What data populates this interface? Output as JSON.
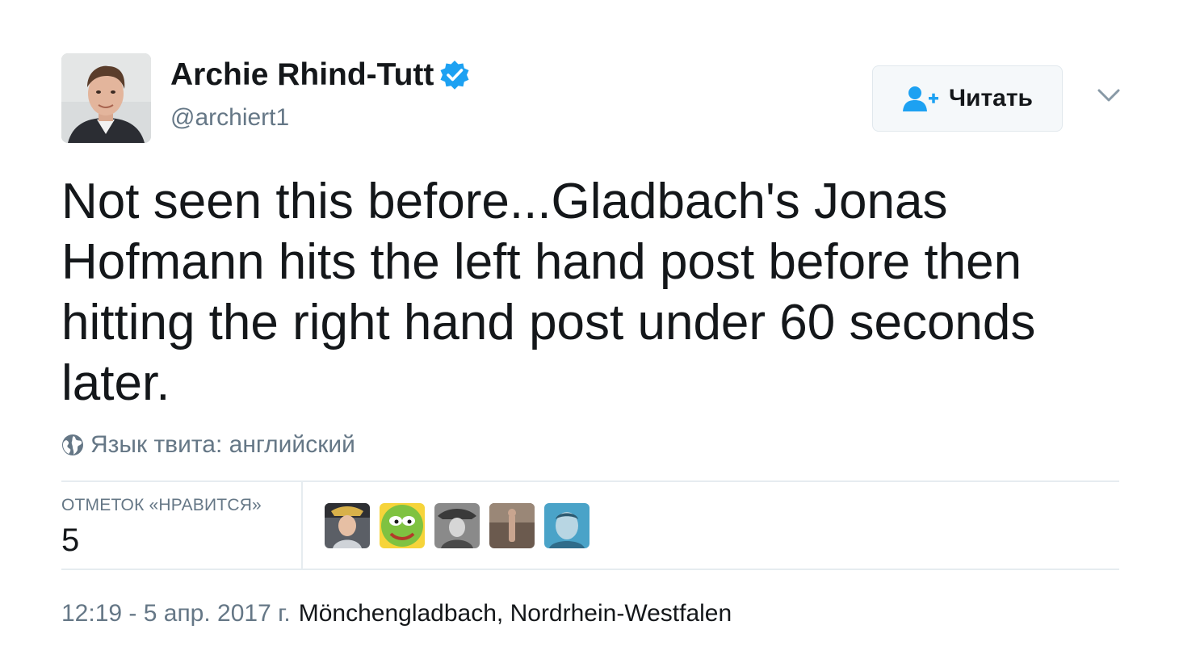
{
  "author": {
    "display_name": "Archie Rhind-Tutt",
    "handle": "@archiert1",
    "verified": true
  },
  "follow_button": {
    "label": "Читать"
  },
  "tweet": {
    "text": "Not seen this before...Gladbach's Jonas Hofmann hits the left hand post before then hitting the right hand post under 60 seconds later.",
    "language_note": "Язык твита: английский"
  },
  "stats": {
    "likes_label": "ОТМЕТОК «НРАВИТСЯ»",
    "likes_value": "5"
  },
  "meta": {
    "timestamp": "12:19 - 5 апр. 2017 г.",
    "location": "Mönchengladbach, Nordrhein-Westfalen"
  },
  "colors": {
    "accent": "#1da1f2",
    "text": "#14171a",
    "secondary": "#657786",
    "divider": "#e6ecf0"
  },
  "icons": {
    "verified": "verified-badge-icon",
    "follow": "follow-person-plus-icon",
    "caret": "chevron-down-icon",
    "globe": "globe-icon"
  }
}
